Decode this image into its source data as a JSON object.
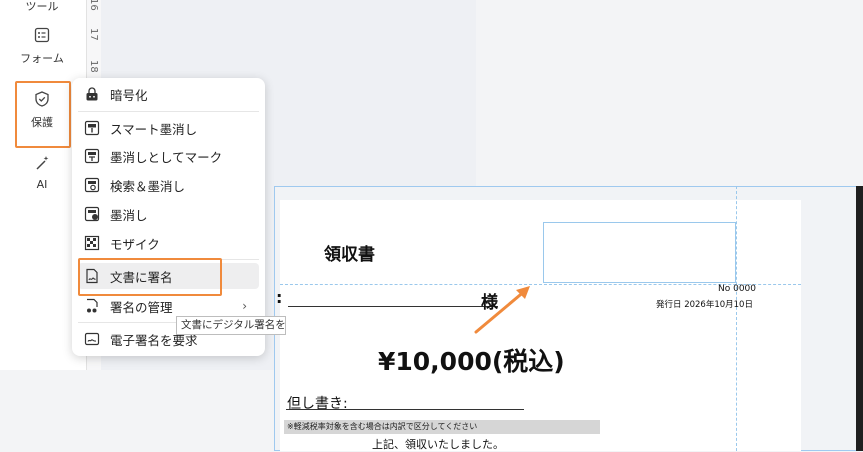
{
  "toolbar": {
    "top_partial_label": "ツール",
    "form_label": "フォーム",
    "protect_label": "保護",
    "ai_label": "AI"
  },
  "ruler": {
    "marks": [
      "16",
      "17",
      "18"
    ]
  },
  "menu": {
    "items": [
      {
        "label": "暗号化",
        "icon": "lock-icon"
      },
      {
        "label": "スマート墨消し",
        "icon": "smart-redact-icon"
      },
      {
        "label": "墨消しとしてマーク",
        "icon": "mark-redact-icon"
      },
      {
        "label": "検索＆墨消し",
        "icon": "search-redact-icon"
      },
      {
        "label": "墨消し",
        "icon": "redact-icon"
      },
      {
        "label": "モザイク",
        "icon": "mosaic-icon"
      },
      {
        "label": "文書に署名",
        "icon": "sign-document-icon"
      },
      {
        "label": "署名の管理",
        "icon": "manage-signature-icon"
      },
      {
        "label": "電子署名を要求",
        "icon": "request-esign-icon"
      }
    ],
    "tooltip": "文書にデジタル署名を"
  },
  "document": {
    "title": "領収書",
    "recipient_suffix": "様",
    "number": "No  0000",
    "issue_date": "発行日 2026年10月10日",
    "amount": "¥10,000(税込)",
    "proviso_label": "但し書き:",
    "note": "※軽減税率対象を含む場合は内訳で区分してください",
    "closing": "上記、領収いたしました。",
    "colon": ":"
  },
  "colors": {
    "accent_orange": "#f08a3c",
    "guide_blue": "#9ac8ec"
  }
}
